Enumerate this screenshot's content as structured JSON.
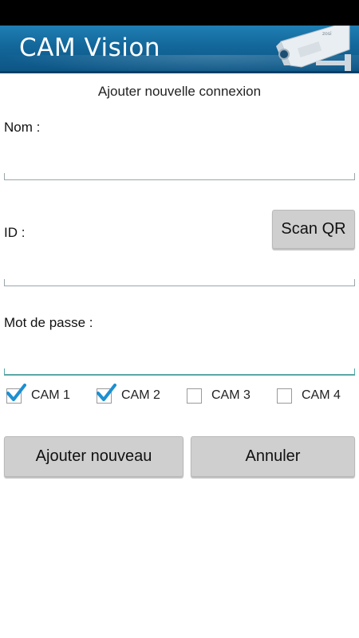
{
  "header": {
    "title": "CAM Vision",
    "icon": "security-camera-icon",
    "colors": {
      "header_top": "#1f7fb4",
      "header_bottom": "#0d5686"
    }
  },
  "form": {
    "title": "Ajouter nouvelle connexion",
    "name_label": "Nom :",
    "name_value": "",
    "id_label": "ID :",
    "id_value": "",
    "scan_qr_label": "Scan QR",
    "password_label": "Mot de passe :",
    "password_value": ""
  },
  "cameras": [
    {
      "label": "CAM 1",
      "checked": true
    },
    {
      "label": "CAM 2",
      "checked": true
    },
    {
      "label": "CAM 3",
      "checked": false
    },
    {
      "label": "CAM 4",
      "checked": false
    }
  ],
  "actions": {
    "add_label": "Ajouter nouveau",
    "cancel_label": "Annuler"
  },
  "colors": {
    "check_color": "#1e8fd0",
    "button_bg": "#cfcfcf"
  }
}
